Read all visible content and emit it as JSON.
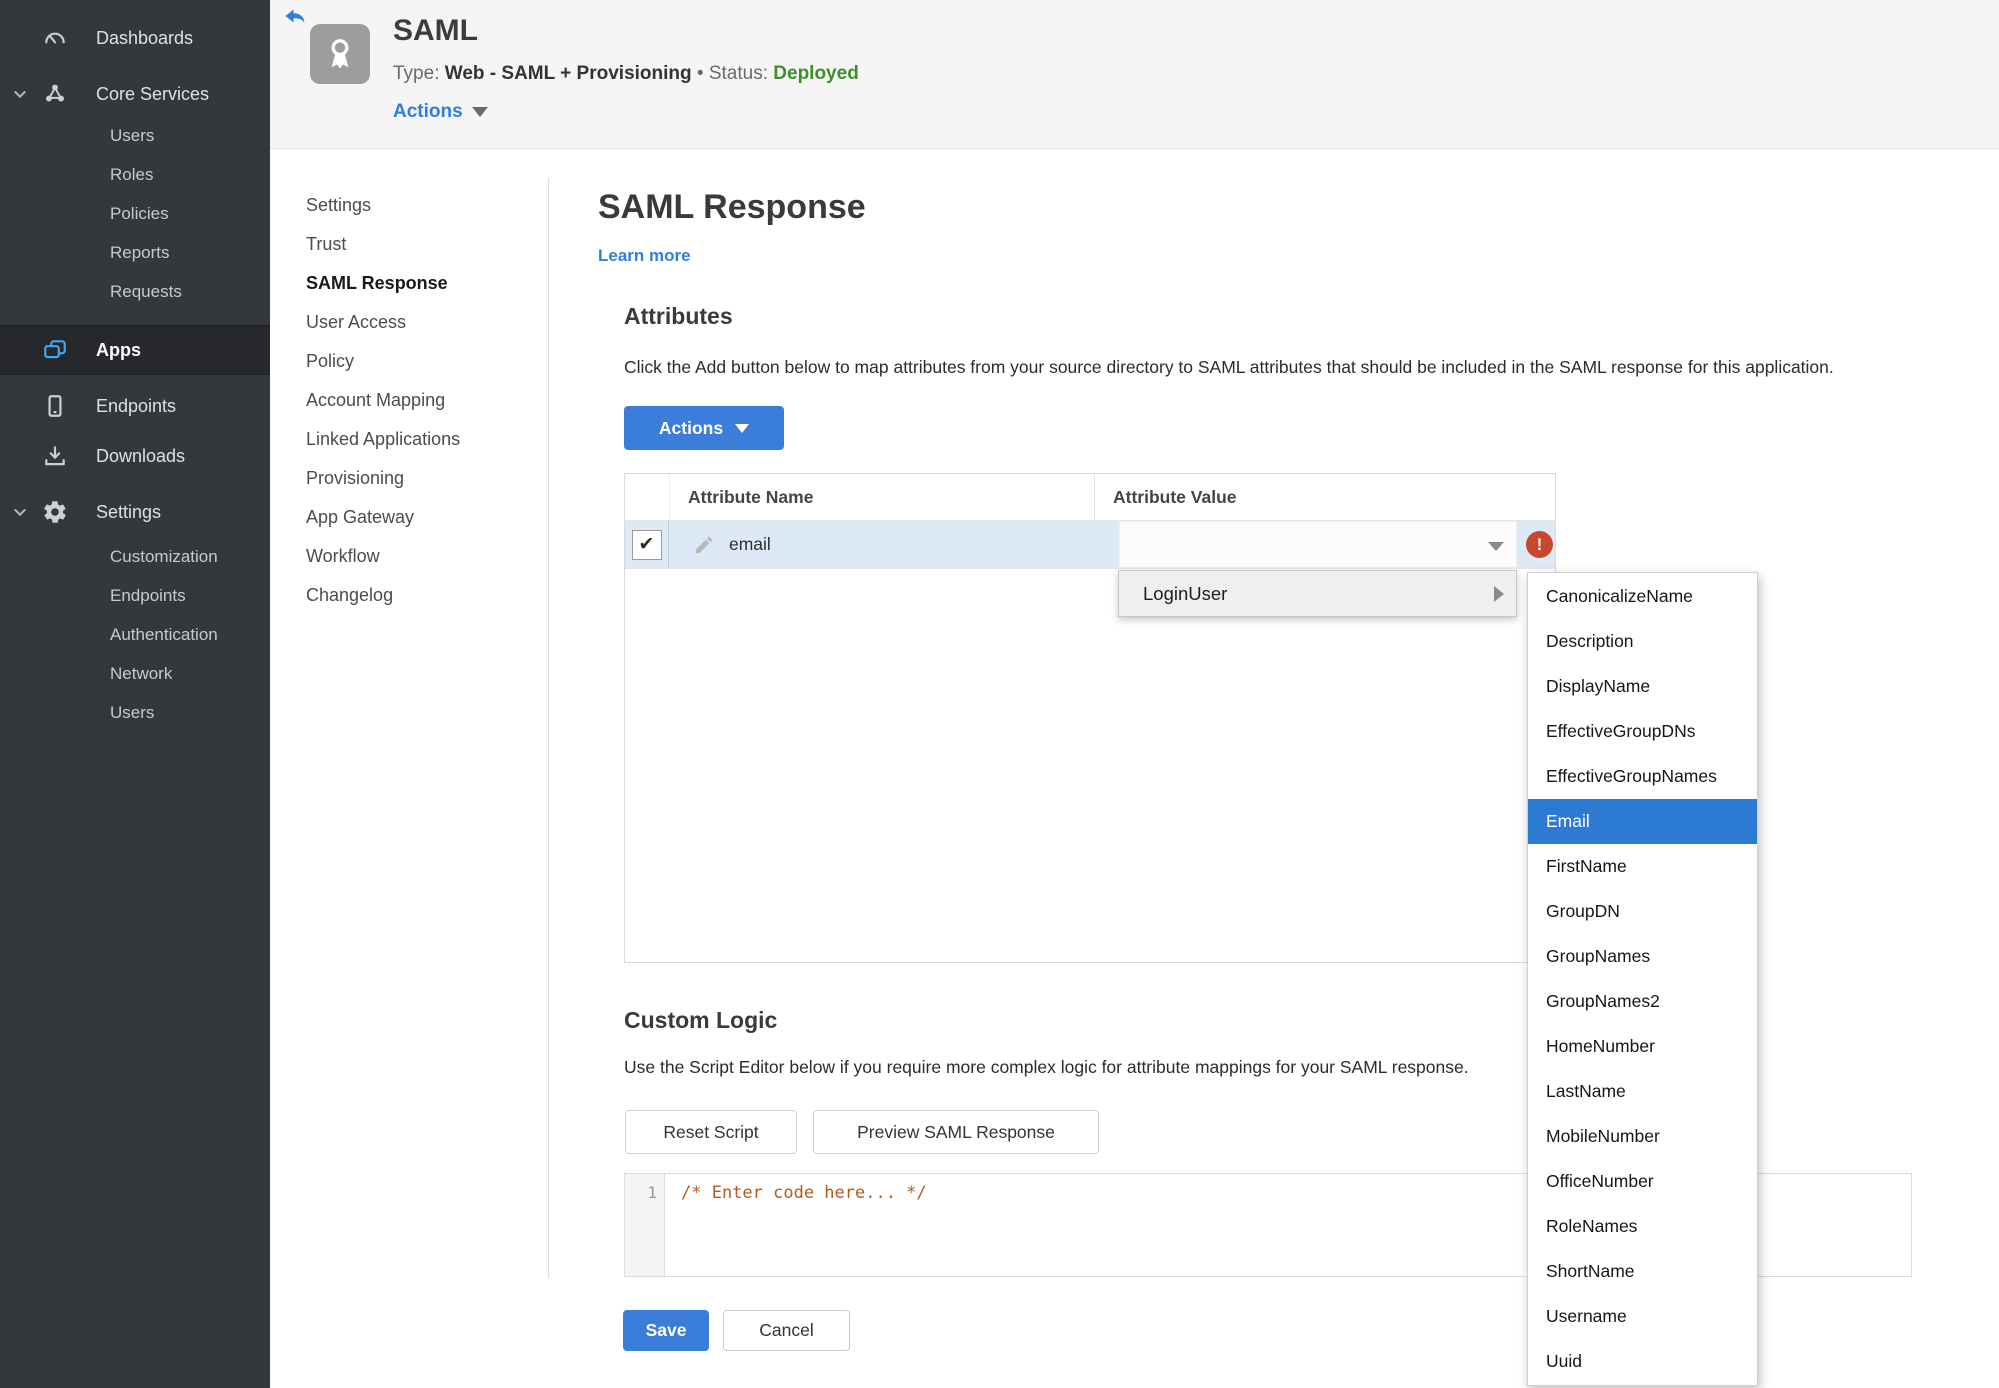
{
  "sidebar": {
    "dashboards": "Dashboards",
    "core_services": "Core Services",
    "core_sub": [
      "Users",
      "Roles",
      "Policies",
      "Reports",
      "Requests"
    ],
    "apps": "Apps",
    "endpoints": "Endpoints",
    "downloads": "Downloads",
    "settings": "Settings",
    "settings_sub": [
      "Customization",
      "Endpoints",
      "Authentication",
      "Network",
      "Users"
    ]
  },
  "header": {
    "title": "SAML",
    "type_label": "Type:",
    "type_value": "Web - SAML + Provisioning",
    "separator": "•",
    "status_label": "Status:",
    "status_value": "Deployed",
    "actions_label": "Actions"
  },
  "subnav": {
    "items": [
      "Settings",
      "Trust",
      "SAML Response",
      "User Access",
      "Policy",
      "Account Mapping",
      "Linked Applications",
      "Provisioning",
      "App Gateway",
      "Workflow",
      "Changelog"
    ],
    "active": "SAML Response"
  },
  "main": {
    "title": "SAML Response",
    "learn_more": "Learn more",
    "attributes": {
      "heading": "Attributes",
      "description": "Click the Add button below to map attributes from your source directory to SAML attributes that should be included in the SAML response for this application.",
      "actions_button": "Actions",
      "table": {
        "columns": [
          "Attribute Name",
          "Attribute Value"
        ],
        "rows": [
          {
            "name": "email",
            "value": "",
            "checked": true,
            "error": true
          }
        ]
      }
    },
    "menu": {
      "label": "LoginUser"
    },
    "submenu": {
      "items": [
        "CanonicalizeName",
        "Description",
        "DisplayName",
        "EffectiveGroupDNs",
        "EffectiveGroupNames",
        "Email",
        "FirstName",
        "GroupDN",
        "GroupNames",
        "GroupNames2",
        "HomeNumber",
        "LastName",
        "MobileNumber",
        "OfficeNumber",
        "RoleNames",
        "ShortName",
        "Username",
        "Uuid"
      ],
      "selected": "Email"
    },
    "custom_logic": {
      "heading": "Custom Logic",
      "description": "Use the Script Editor below if you require more complex logic for attribute mappings for your SAML response.",
      "reset_button": "Reset Script",
      "preview_button": "Preview SAML Response",
      "editor": {
        "line_number": "1",
        "code": "/* Enter code here... */"
      }
    },
    "footer": {
      "save": "Save",
      "cancel": "Cancel"
    }
  },
  "icons": {
    "check": "✔",
    "exclamation": "!"
  },
  "colors": {
    "accent_blue": "#3b7ed9",
    "link_blue": "#2f7fe0",
    "status_green": "#3f8f29",
    "error_red": "#c9472c",
    "selection_blue": "#2d7ad2",
    "row_selected": "#dde9f7",
    "sidebar_bg": "#35383b"
  }
}
